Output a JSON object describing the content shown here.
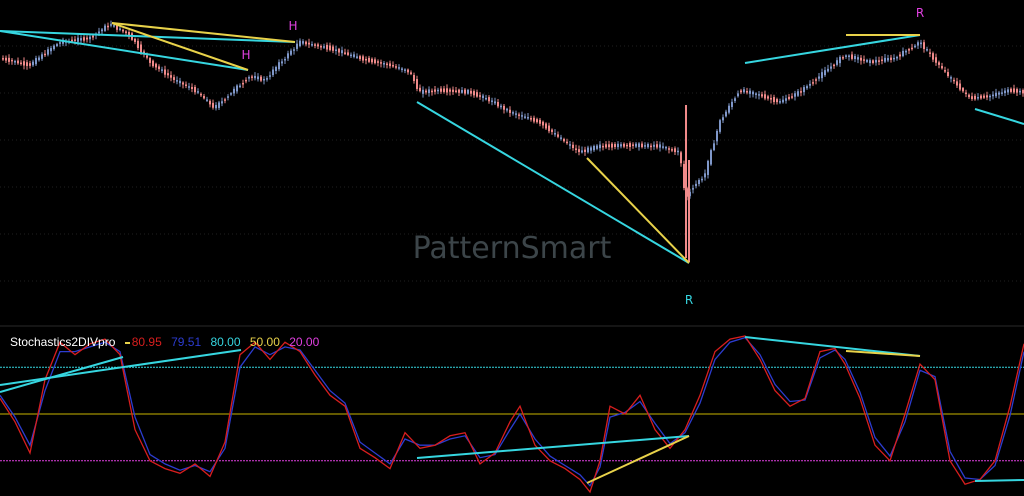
{
  "watermark": "PatternSmart",
  "colors": {
    "background": "#000000",
    "up_candle": "#7f97c9",
    "down_candle": "#f08a8a",
    "cyan": "#36d6e0",
    "yellow": "#e8d24a",
    "magenta": "#e040e0",
    "stoch_k": "#d81e1e",
    "stoch_d": "#2c3cd0",
    "level_50": "#c8b400"
  },
  "chart_data": [
    {
      "type": "candlestick",
      "title": "",
      "xlim": [
        0,
        1024
      ],
      "price_path": [
        [
          0,
          58
        ],
        [
          30,
          65
        ],
        [
          60,
          42
        ],
        [
          90,
          38
        ],
        [
          110,
          24
        ],
        [
          130,
          35
        ],
        [
          150,
          62
        ],
        [
          175,
          80
        ],
        [
          195,
          90
        ],
        [
          215,
          108
        ],
        [
          232,
          92
        ],
        [
          250,
          76
        ],
        [
          265,
          80
        ],
        [
          285,
          58
        ],
        [
          300,
          42
        ],
        [
          330,
          48
        ],
        [
          360,
          58
        ],
        [
          390,
          65
        ],
        [
          410,
          72
        ],
        [
          420,
          92
        ],
        [
          440,
          90
        ],
        [
          470,
          92
        ],
        [
          490,
          100
        ],
        [
          510,
          112
        ],
        [
          540,
          122
        ],
        [
          560,
          138
        ],
        [
          580,
          152
        ],
        [
          600,
          146
        ],
        [
          630,
          145
        ],
        [
          660,
          146
        ],
        [
          680,
          152
        ],
        [
          686,
          200
        ],
        [
          692,
          188
        ],
        [
          705,
          175
        ],
        [
          720,
          122
        ],
        [
          740,
          90
        ],
        [
          760,
          95
        ],
        [
          780,
          102
        ],
        [
          800,
          92
        ],
        [
          820,
          76
        ],
        [
          845,
          55
        ],
        [
          870,
          62
        ],
        [
          895,
          58
        ],
        [
          920,
          42
        ],
        [
          945,
          72
        ],
        [
          970,
          98
        ],
        [
          990,
          96
        ],
        [
          1010,
          90
        ],
        [
          1024,
          92
        ]
      ],
      "markers": [
        {
          "text": "H",
          "x": 293,
          "y": 30,
          "color": "magenta"
        },
        {
          "text": "H",
          "x": 246,
          "y": 59,
          "color": "magenta"
        },
        {
          "text": "R",
          "x": 920,
          "y": 17,
          "color": "magenta"
        },
        {
          "text": "R",
          "x": 689,
          "y": 304,
          "color": "cyan"
        }
      ],
      "trend_lines": [
        {
          "color": "cyan",
          "from": [
            0,
            31
          ],
          "to": [
            295,
            42
          ]
        },
        {
          "color": "cyan",
          "from": [
            0,
            31
          ],
          "to": [
            248,
            70
          ]
        },
        {
          "color": "yellow",
          "from": [
            112,
            23
          ],
          "to": [
            295,
            42
          ]
        },
        {
          "color": "yellow",
          "from": [
            112,
            23
          ],
          "to": [
            248,
            70
          ]
        },
        {
          "color": "cyan",
          "from": [
            417,
            102
          ],
          "to": [
            689,
            263
          ]
        },
        {
          "color": "yellow",
          "from": [
            587,
            158
          ],
          "to": [
            689,
            263
          ]
        },
        {
          "color": "cyan",
          "from": [
            745,
            63
          ],
          "to": [
            920,
            35
          ]
        },
        {
          "color": "yellow",
          "from": [
            846,
            35
          ],
          "to": [
            920,
            35
          ]
        },
        {
          "color": "cyan",
          "from": [
            975,
            109
          ],
          "to": [
            1024,
            124
          ]
        }
      ]
    },
    {
      "type": "line",
      "title": "Stochastics2DIVpro",
      "legend": [
        {
          "label": "Stochastics2DIVpro",
          "color": "#ffffff"
        },
        {
          "label": "80.95",
          "color": "stoch_k"
        },
        {
          "label": "79.51",
          "color": "stoch_d"
        },
        {
          "label": "80.00",
          "color": "cyan"
        },
        {
          "label": "50.00",
          "color": "yellow"
        },
        {
          "label": "20.00",
          "color": "magenta"
        }
      ],
      "ylim": [
        0,
        100
      ],
      "levels": [
        {
          "value": 80,
          "color": "cyan"
        },
        {
          "value": 50,
          "color": "level_50"
        },
        {
          "value": 20,
          "color": "magenta"
        }
      ],
      "k_series": [
        [
          0,
          60
        ],
        [
          15,
          45
        ],
        [
          30,
          25
        ],
        [
          45,
          72
        ],
        [
          60,
          96
        ],
        [
          75,
          88
        ],
        [
          90,
          95
        ],
        [
          105,
          98
        ],
        [
          120,
          88
        ],
        [
          135,
          40
        ],
        [
          150,
          20
        ],
        [
          165,
          15
        ],
        [
          180,
          12
        ],
        [
          195,
          18
        ],
        [
          210,
          10
        ],
        [
          225,
          32
        ],
        [
          240,
          88
        ],
        [
          255,
          96
        ],
        [
          270,
          85
        ],
        [
          285,
          96
        ],
        [
          300,
          90
        ],
        [
          315,
          75
        ],
        [
          330,
          62
        ],
        [
          345,
          55
        ],
        [
          360,
          28
        ],
        [
          375,
          22
        ],
        [
          390,
          15
        ],
        [
          405,
          38
        ],
        [
          420,
          28
        ],
        [
          435,
          30
        ],
        [
          450,
          36
        ],
        [
          465,
          38
        ],
        [
          480,
          18
        ],
        [
          495,
          25
        ],
        [
          510,
          45
        ],
        [
          520,
          55
        ],
        [
          535,
          30
        ],
        [
          550,
          20
        ],
        [
          565,
          15
        ],
        [
          580,
          8
        ],
        [
          590,
          0
        ],
        [
          600,
          20
        ],
        [
          610,
          55
        ],
        [
          625,
          50
        ],
        [
          640,
          62
        ],
        [
          655,
          40
        ],
        [
          670,
          28
        ],
        [
          685,
          40
        ],
        [
          700,
          62
        ],
        [
          715,
          90
        ],
        [
          730,
          98
        ],
        [
          745,
          100
        ],
        [
          760,
          85
        ],
        [
          775,
          65
        ],
        [
          790,
          55
        ],
        [
          805,
          60
        ],
        [
          820,
          90
        ],
        [
          835,
          92
        ],
        [
          845,
          82
        ],
        [
          860,
          60
        ],
        [
          875,
          30
        ],
        [
          890,
          20
        ],
        [
          905,
          50
        ],
        [
          920,
          82
        ],
        [
          935,
          72
        ],
        [
          950,
          20
        ],
        [
          965,
          5
        ],
        [
          980,
          8
        ],
        [
          995,
          20
        ],
        [
          1010,
          55
        ],
        [
          1024,
          95
        ]
      ],
      "d_series": [
        [
          0,
          62
        ],
        [
          15,
          48
        ],
        [
          30,
          30
        ],
        [
          45,
          65
        ],
        [
          60,
          90
        ],
        [
          75,
          90
        ],
        [
          90,
          93
        ],
        [
          105,
          96
        ],
        [
          120,
          90
        ],
        [
          135,
          48
        ],
        [
          150,
          24
        ],
        [
          165,
          18
        ],
        [
          180,
          14
        ],
        [
          195,
          17
        ],
        [
          210,
          13
        ],
        [
          225,
          28
        ],
        [
          240,
          80
        ],
        [
          255,
          93
        ],
        [
          270,
          88
        ],
        [
          285,
          93
        ],
        [
          300,
          91
        ],
        [
          315,
          78
        ],
        [
          330,
          65
        ],
        [
          345,
          57
        ],
        [
          360,
          32
        ],
        [
          375,
          25
        ],
        [
          390,
          18
        ],
        [
          405,
          34
        ],
        [
          420,
          30
        ],
        [
          435,
          30
        ],
        [
          450,
          34
        ],
        [
          465,
          36
        ],
        [
          480,
          22
        ],
        [
          495,
          24
        ],
        [
          510,
          40
        ],
        [
          520,
          50
        ],
        [
          535,
          34
        ],
        [
          550,
          23
        ],
        [
          565,
          17
        ],
        [
          580,
          11
        ],
        [
          590,
          4
        ],
        [
          600,
          16
        ],
        [
          610,
          48
        ],
        [
          625,
          51
        ],
        [
          640,
          58
        ],
        [
          655,
          44
        ],
        [
          670,
          31
        ],
        [
          685,
          38
        ],
        [
          700,
          57
        ],
        [
          715,
          85
        ],
        [
          730,
          96
        ],
        [
          745,
          99
        ],
        [
          760,
          88
        ],
        [
          775,
          69
        ],
        [
          790,
          58
        ],
        [
          805,
          59
        ],
        [
          820,
          86
        ],
        [
          835,
          91
        ],
        [
          845,
          85
        ],
        [
          860,
          64
        ],
        [
          875,
          35
        ],
        [
          890,
          23
        ],
        [
          905,
          45
        ],
        [
          920,
          78
        ],
        [
          935,
          74
        ],
        [
          950,
          26
        ],
        [
          965,
          9
        ],
        [
          980,
          8
        ],
        [
          995,
          17
        ],
        [
          1010,
          49
        ],
        [
          1024,
          90
        ]
      ],
      "trend_lines": [
        {
          "color": "cyan",
          "from": [
            0,
            392
          ],
          "to": [
            123,
            357
          ]
        },
        {
          "color": "cyan",
          "from": [
            0,
            385
          ],
          "to": [
            241,
            350
          ]
        },
        {
          "color": "cyan",
          "from": [
            417,
            458
          ],
          "to": [
            689,
            436
          ]
        },
        {
          "color": "yellow",
          "from": [
            587,
            483
          ],
          "to": [
            689,
            436
          ]
        },
        {
          "color": "cyan",
          "from": [
            745,
            337
          ],
          "to": [
            920,
            356
          ]
        },
        {
          "color": "yellow",
          "from": [
            846,
            351
          ],
          "to": [
            920,
            356
          ]
        },
        {
          "color": "cyan",
          "from": [
            975,
            481
          ],
          "to": [
            1024,
            480
          ]
        }
      ]
    }
  ]
}
